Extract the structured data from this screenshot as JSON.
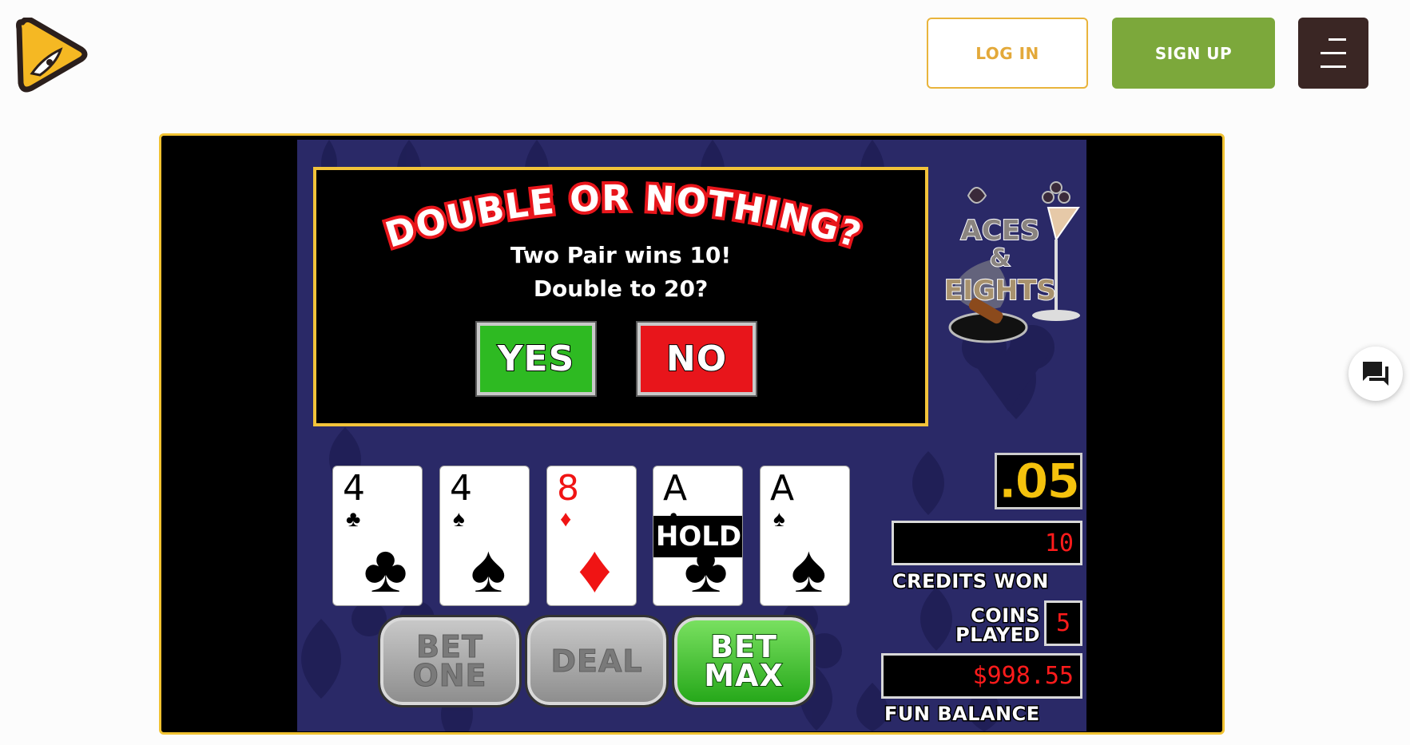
{
  "header": {
    "logo_icon": "rocket-play-icon",
    "login_label": "LOG IN",
    "signup_label": "SIGN UP",
    "menu_icon": "hamburger-menu-icon"
  },
  "colors": {
    "accent_yellow": "#f1c231",
    "signup_green": "#7ca83b",
    "menu_brown": "#3a2624",
    "felt_blue": "#2a2967"
  },
  "game": {
    "dialog": {
      "title": "DOUBLE OR NOTHING?",
      "line1": "Two Pair wins 10!",
      "line2": "Double to 20?",
      "yes_label": "YES",
      "no_label": "NO"
    },
    "logo": {
      "line1": "ACES",
      "line2": "&",
      "line3": "EIGHTS"
    },
    "cards": [
      {
        "rank": "4",
        "suit": "♣",
        "color": "black",
        "held": false
      },
      {
        "rank": "4",
        "suit": "♠",
        "color": "black",
        "held": false
      },
      {
        "rank": "8",
        "suit": "♦",
        "color": "red",
        "held": false
      },
      {
        "rank": "A",
        "suit": "♣",
        "color": "black",
        "held": true
      },
      {
        "rank": "A",
        "suit": "♠",
        "color": "black",
        "held": false
      }
    ],
    "hold_label": "HOLD",
    "buttons": {
      "bet_one": [
        "BET",
        "ONE"
      ],
      "deal": "DEAL",
      "bet_max": [
        "BET",
        "MAX"
      ]
    },
    "denomination": ".05",
    "credits_won_value": "10",
    "credits_won_label": "CREDITS WON",
    "coins_played_label": [
      "COINS",
      "PLAYED"
    ],
    "coins_played_value": "5",
    "fun_balance_value": "$998.55",
    "fun_balance_label": "FUN BALANCE"
  },
  "chat": {
    "icon": "chat-bubbles-icon"
  }
}
